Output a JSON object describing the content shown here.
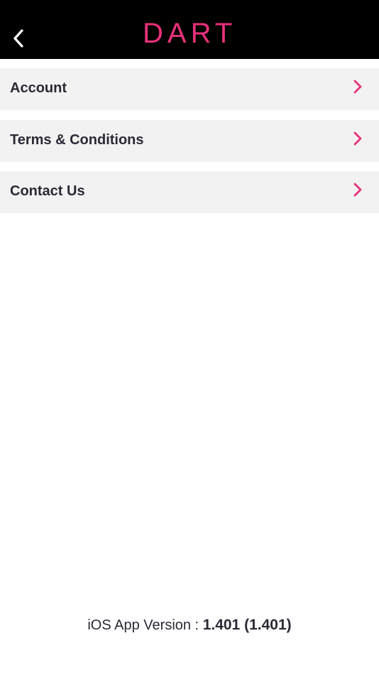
{
  "header": {
    "logo_text": "DART",
    "back_icon": "chevron-left-icon",
    "background_color": "#000000",
    "logo_color": "#e8317a"
  },
  "menu": {
    "items": [
      {
        "label": "Account",
        "icon": "chevron-right-icon"
      },
      {
        "label": "Terms & Conditions",
        "icon": "chevron-right-icon"
      },
      {
        "label": "Contact Us",
        "icon": "chevron-right-icon"
      }
    ],
    "accent_color": "#e8317a",
    "item_background": "#f2f2f2"
  },
  "footer": {
    "version_label": "iOS App Version : ",
    "version_value": "1.401 (1.401)"
  }
}
